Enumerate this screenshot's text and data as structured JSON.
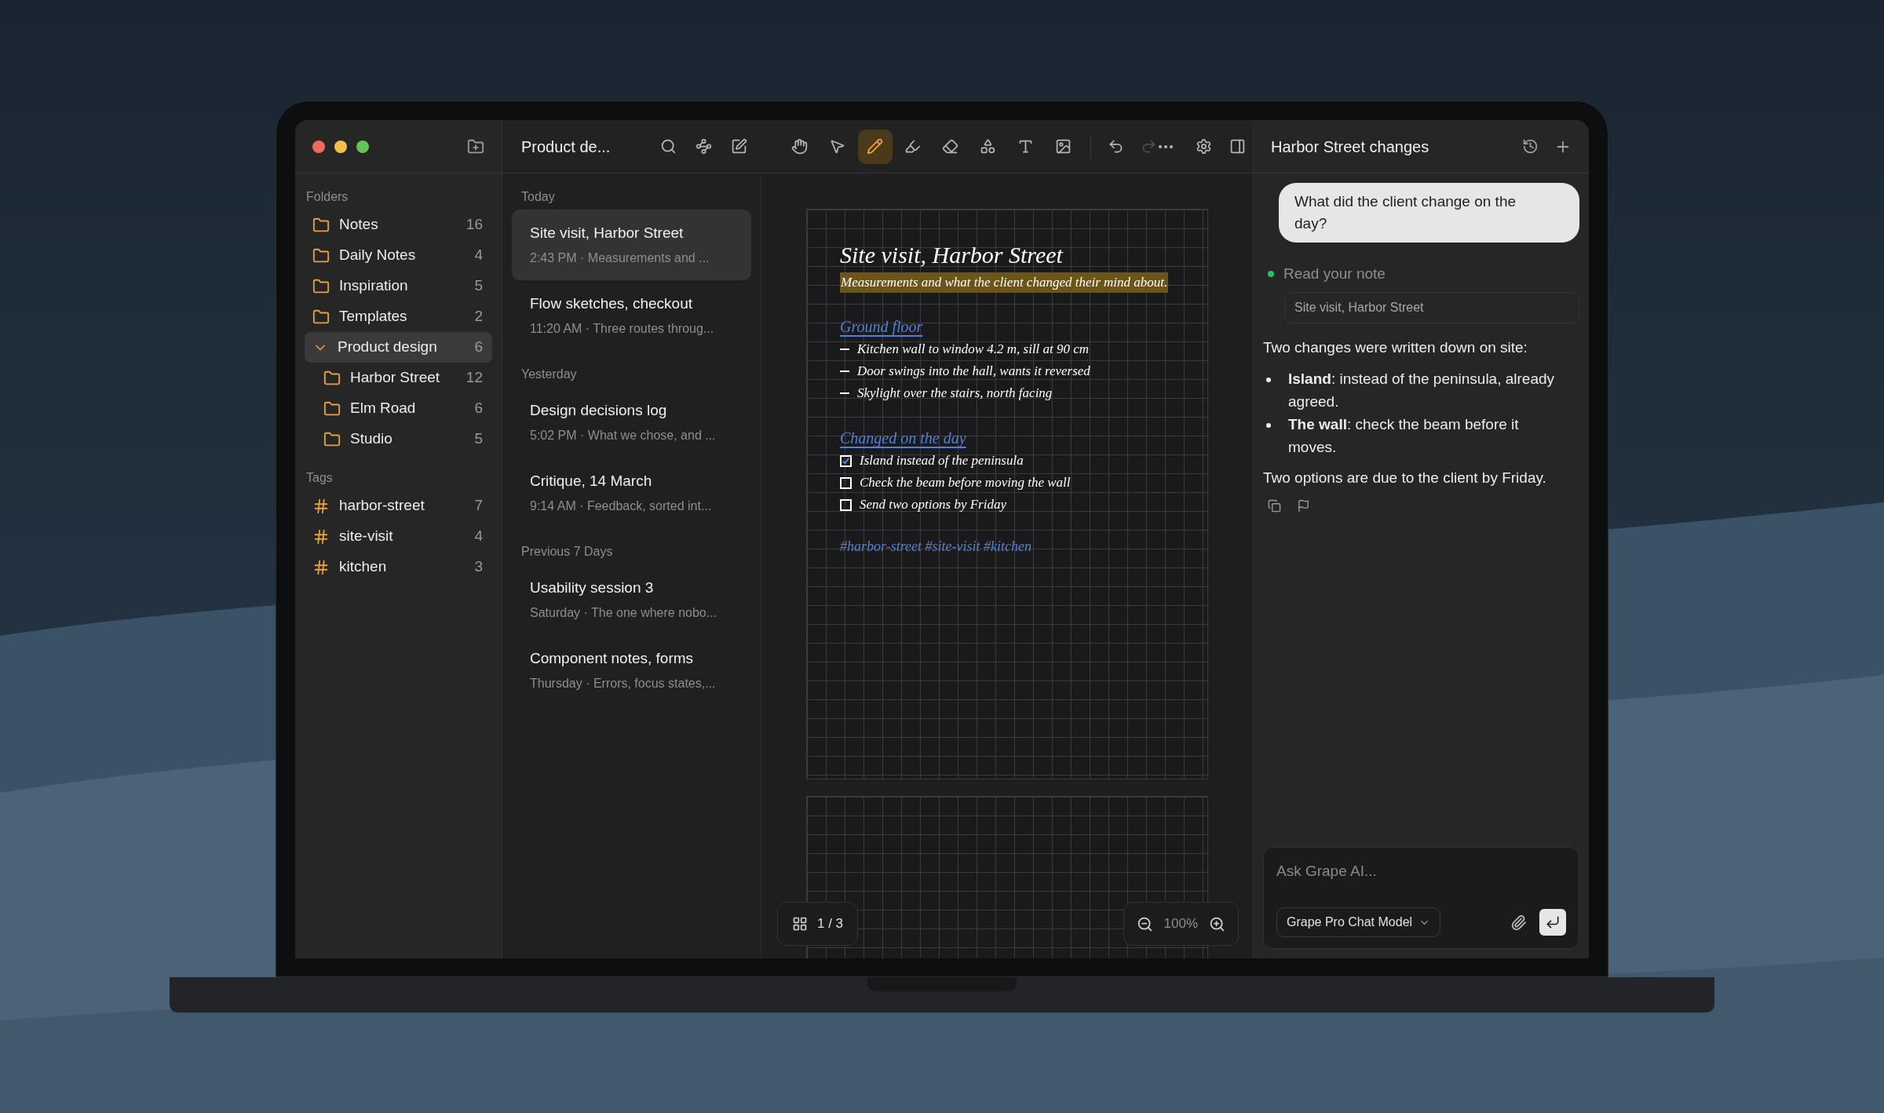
{
  "sidebar": {
    "folders_label": "Folders",
    "folders": [
      {
        "name": "Notes",
        "count": "16",
        "selected": false
      },
      {
        "name": "Daily Notes",
        "count": "4",
        "selected": false
      },
      {
        "name": "Inspiration",
        "count": "5",
        "selected": false
      },
      {
        "name": "Templates",
        "count": "2",
        "selected": false
      },
      {
        "name": "Product design",
        "count": "6",
        "selected": true,
        "expanded": true,
        "children": [
          {
            "name": "Harbor Street",
            "count": "12",
            "selected": false
          },
          {
            "name": "Elm Road",
            "count": "6",
            "selected": false
          },
          {
            "name": "Studio",
            "count": "5",
            "selected": false
          }
        ]
      }
    ],
    "tags_label": "Tags",
    "tags": [
      {
        "name": "harbor-street",
        "count": "7"
      },
      {
        "name": "site-visit",
        "count": "4"
      },
      {
        "name": "kitchen",
        "count": "3"
      }
    ]
  },
  "toolbar": {
    "title": "Product de...",
    "tools": [
      {
        "selected": false
      },
      {
        "selected": false
      },
      {
        "selected": true
      },
      {
        "selected": false
      },
      {
        "selected": false
      },
      {
        "selected": false
      },
      {
        "selected": false
      },
      {
        "selected": false
      }
    ],
    "history": [
      {
        "disabled": false
      },
      {
        "disabled": true
      }
    ]
  },
  "note_list": [
    {
      "label": "Today",
      "notes": [
        {
          "title": "Site visit, Harbor Street",
          "meta": "2:43 PM · Measurements and ...",
          "selected": true
        },
        {
          "title": "Flow sketches, checkout",
          "meta": "11:20 AM · Three routes throug...",
          "selected": false
        }
      ]
    },
    {
      "label": "Yesterday",
      "notes": [
        {
          "title": "Design decisions log",
          "meta": "5:02 PM · What we chose, and ...",
          "selected": false
        },
        {
          "title": "Critique, 14 March",
          "meta": "9:14 AM · Feedback, sorted int...",
          "selected": false
        }
      ]
    },
    {
      "label": "Previous 7 Days",
      "notes": [
        {
          "title": "Usability session 3",
          "meta": "Saturday · The one where nobo...",
          "selected": false
        },
        {
          "title": "Component notes, forms",
          "meta": "Thursday · Errors, focus states,...",
          "selected": false
        }
      ]
    }
  ],
  "canvas": {
    "title": "Site visit, Harbor Street",
    "subtitle": "Measurements and what the client changed their mind about.",
    "sections": [
      {
        "heading": "Ground floor",
        "items": [
          {
            "kind": "bullet",
            "text": "Kitchen wall to window 4.2 m, sill at 90 cm"
          },
          {
            "kind": "bullet",
            "text": "Door swings into the hall, wants it reversed"
          },
          {
            "kind": "bullet",
            "text": "Skylight over the stairs, north facing"
          }
        ]
      },
      {
        "heading": "Changed on the day",
        "items": [
          {
            "kind": "checkbox",
            "checked": true,
            "text": "Island instead of the peninsula"
          },
          {
            "kind": "checkbox",
            "checked": false,
            "text": "Check the beam before moving the wall"
          },
          {
            "kind": "checkbox",
            "checked": false,
            "text": "Send two options by Friday"
          }
        ]
      }
    ],
    "tags": "#harbor-street #site-visit #kitchen",
    "page": "1 / 3",
    "zoom": "100%"
  },
  "assistant": {
    "title": "Harbor Street changes",
    "question": "What did the client change on the day?",
    "step": {
      "label": "Read your note",
      "color": "#22c55e",
      "source": "Site visit, Harbor Street"
    },
    "intro": "Two changes were written down on site:",
    "bullets": [
      "**Island**: instead of the peninsula, already agreed.",
      "**The wall**: check the beam before it moves."
    ],
    "outro": "Two options are due to the client by Friday.",
    "input": {
      "placeholder": "Ask Grape AI...",
      "model": "Grape Pro Chat Model"
    }
  }
}
